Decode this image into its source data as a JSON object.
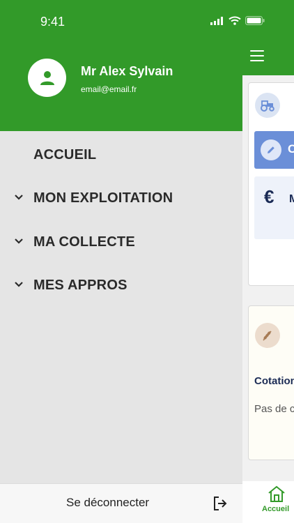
{
  "status_bar": {
    "time": "9:41"
  },
  "drawer": {
    "user": {
      "name": "Mr Alex Sylvain",
      "email": "email@email.fr"
    },
    "menu": [
      {
        "label": "ACCUEIL",
        "expandable": false
      },
      {
        "label": "MON EXPLOITATION",
        "expandable": true
      },
      {
        "label": "MA COLLECTE",
        "expandable": true
      },
      {
        "label": "MES APPROS",
        "expandable": true
      }
    ],
    "logout_label": "Se déconnecter"
  },
  "background": {
    "edit_row_text": "C",
    "euro_symbol": "€",
    "euro_row_text": "M",
    "cotation_text": "Cotation",
    "empty_text": "Pas de c",
    "tab_label": "Accueil"
  },
  "colors": {
    "brand_green": "#329a29",
    "edit_blue": "#6b8fd8",
    "text_navy": "#1b2b55"
  },
  "icons": [
    "menu-icon",
    "tractor-icon",
    "pencil-icon",
    "euro-icon",
    "wheat-icon",
    "home-icon",
    "user-icon",
    "chevron-down-icon",
    "logout-icon",
    "signal-icon",
    "wifi-icon",
    "battery-icon"
  ]
}
